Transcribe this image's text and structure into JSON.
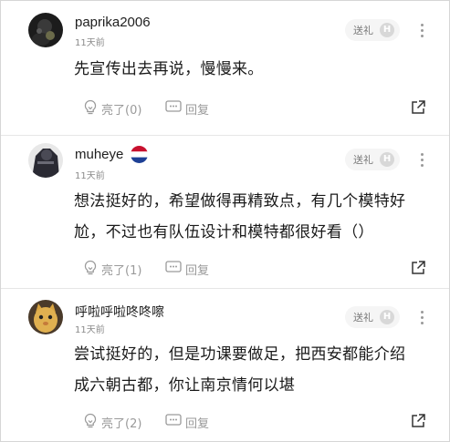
{
  "colors": {
    "text": "#1a1a1a",
    "meta": "#8a8a8a",
    "action": "#9a9a9a",
    "gift_bg": "#f5f5f5"
  },
  "comments": [
    {
      "username": "paprika2006",
      "time": "11天前",
      "content_lines": [
        "先宣传出去再说，慢慢来。"
      ],
      "gift_label": "送礼",
      "gift_icon_text": "H",
      "like_label": "亮了(0)",
      "reply_label": "回复",
      "avatar": "dark-silhouette-avatar",
      "flag": null
    },
    {
      "username": "muheye",
      "time": "11天前",
      "content_lines": [
        "想法挺好的，希望做得再精致点，有几个模特好",
        "尬，不过也有队伍设计和模特都很好看（）"
      ],
      "gift_label": "送礼",
      "gift_icon_text": "H",
      "like_label": "亮了(1)",
      "reply_label": "回复",
      "avatar": "dark-figure-avatar",
      "flag": "netherlands-flag-icon"
    },
    {
      "username": "呼啦呼啦咚咚嚓",
      "time": "11天前",
      "content_lines": [
        "尝试挺好的，但是功课要做足，把西安都能介绍",
        "成六朝古都，你让南京情何以堪"
      ],
      "gift_label": "送礼",
      "gift_icon_text": "H",
      "like_label": "亮了(2)",
      "reply_label": "回复",
      "avatar": "cat-avatar",
      "flag": null
    }
  ]
}
